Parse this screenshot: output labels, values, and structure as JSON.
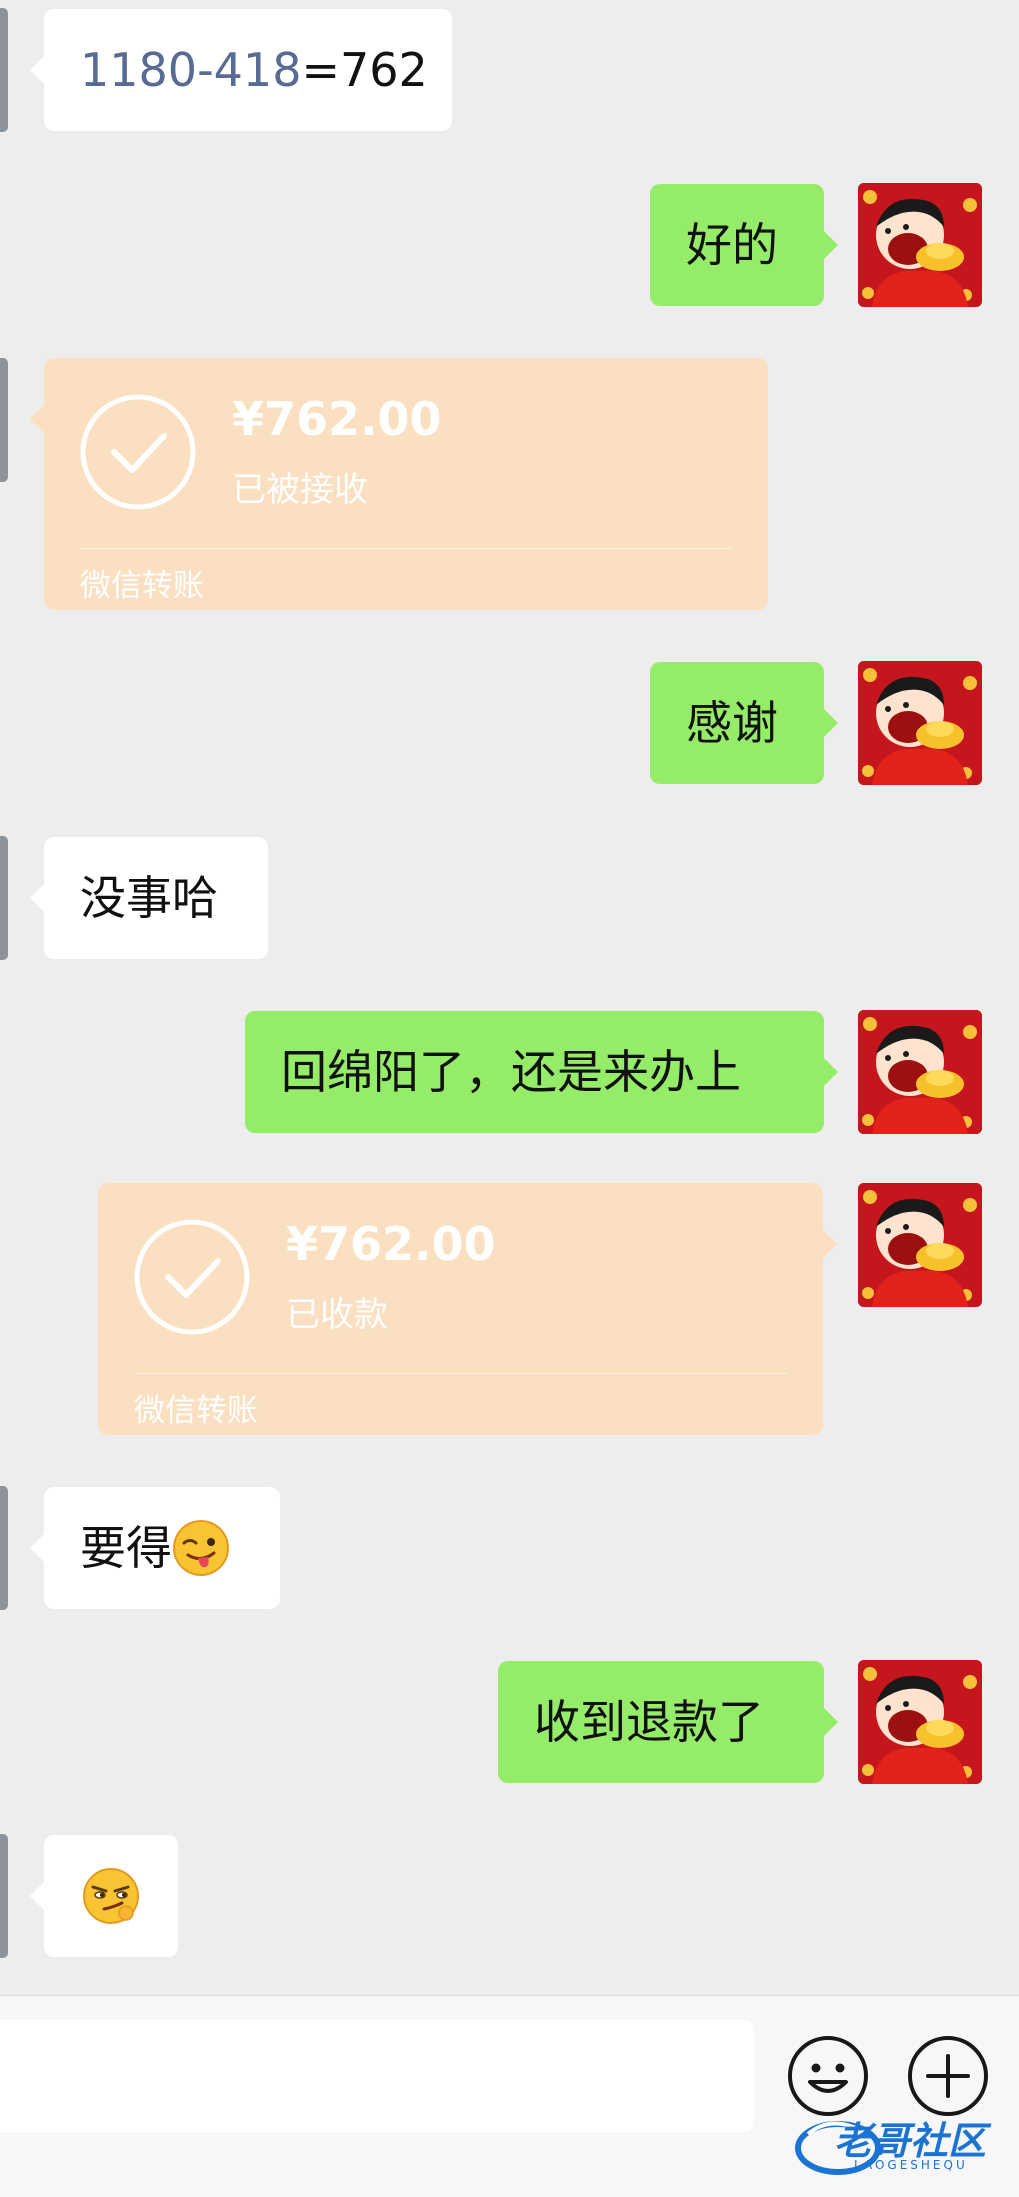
{
  "chat": {
    "msg1": {
      "prefix": "1180-418",
      "suffix": "=762"
    },
    "msg2": "好的",
    "transfer1": {
      "amount": "¥762.00",
      "status": "已被接收",
      "footer": "微信转账"
    },
    "msg3": "感谢",
    "msg4": "没事哈",
    "msg5": "回绵阳了，还是来办上",
    "transfer2": {
      "amount": "¥762.00",
      "status": "已收款",
      "footer": "微信转账"
    },
    "msg6": "要得",
    "msg7": "收到退款了"
  },
  "icons": {
    "checkmark": "check-circle-icon",
    "wink_emoji": "wink-tongue-emoji",
    "smirk_emoji": "smirk-emoji",
    "emoji_button": "smiley-icon",
    "more_button": "plus-circle-icon"
  },
  "colors": {
    "background": "#EDEDED",
    "incoming_bubble": "#FFFFFF",
    "outgoing_bubble": "#95EC69",
    "transfer_card": "#FBDFC1",
    "link_text": "#576B95"
  },
  "input_bar": {
    "placeholder": ""
  },
  "watermark": {
    "title": "老哥社区",
    "subtitle": "LAOGESHEQU"
  }
}
